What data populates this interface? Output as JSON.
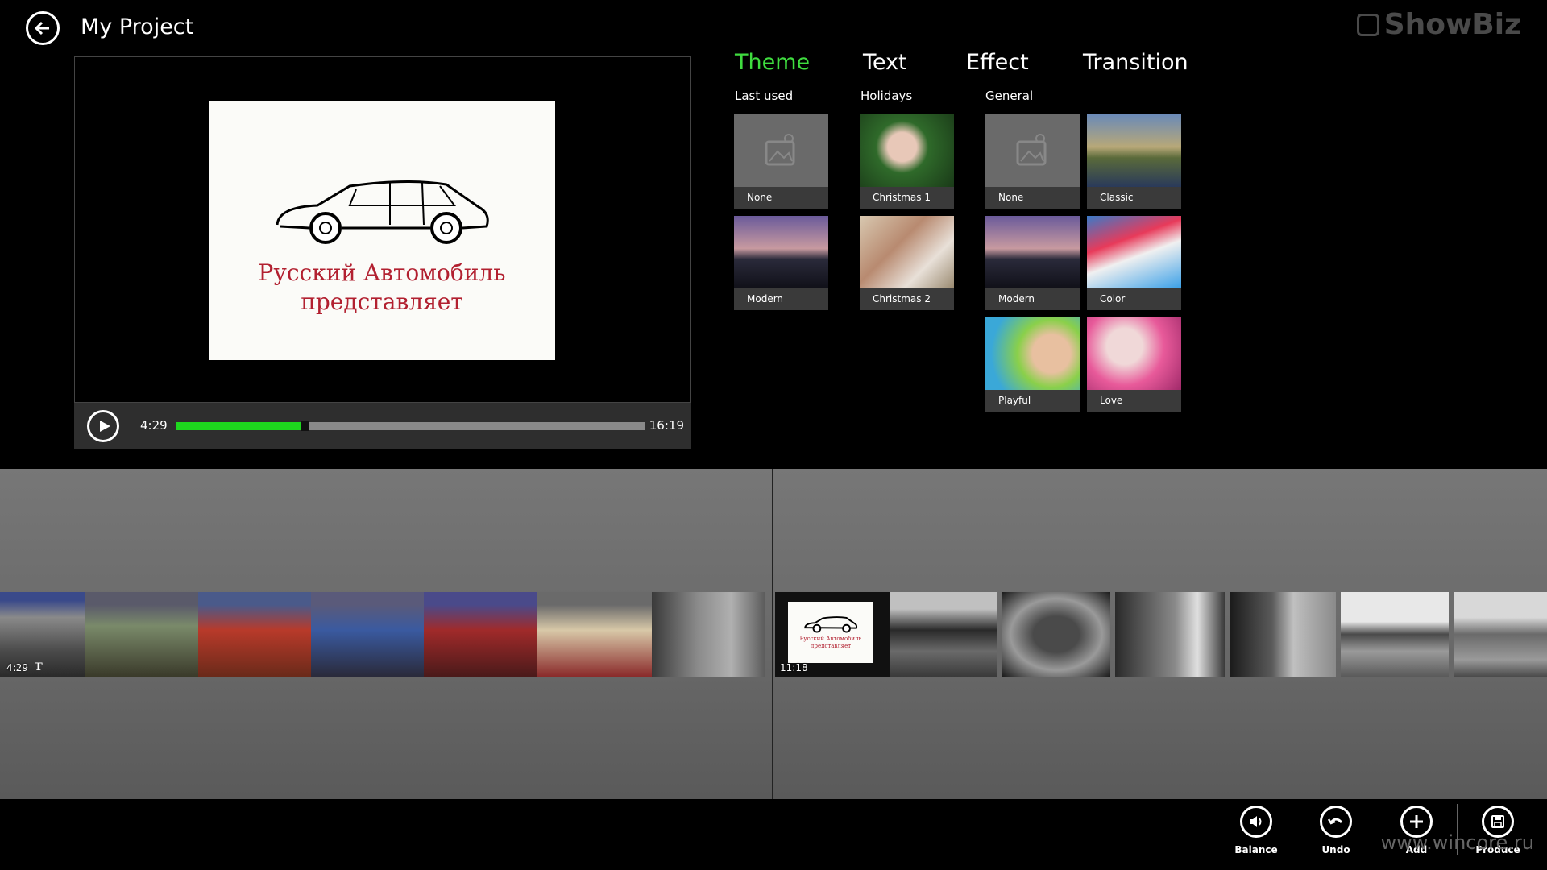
{
  "header": {
    "title": "My Project",
    "brand": "ShowBiz"
  },
  "player": {
    "slide_caption_line1": "Русский Автомобиль",
    "slide_caption_line2": "представляет",
    "current_time": "4:29",
    "total_time": "16:19",
    "progress": 0.27
  },
  "tabs": [
    {
      "label": "Theme",
      "active": true
    },
    {
      "label": "Text",
      "active": false
    },
    {
      "label": "Effect",
      "active": false
    },
    {
      "label": "Transition",
      "active": false
    }
  ],
  "groups": {
    "last_used": {
      "label": "Last used",
      "items": [
        {
          "label": "None"
        },
        {
          "label": "Modern"
        }
      ]
    },
    "holidays": {
      "label": "Holidays",
      "items": [
        {
          "label": "Christmas 1"
        },
        {
          "label": "Christmas 2"
        }
      ]
    },
    "general": {
      "label": "General",
      "items": [
        {
          "label": "None"
        },
        {
          "label": "Classic"
        },
        {
          "label": "Modern"
        },
        {
          "label": "Color"
        },
        {
          "label": "Playful"
        },
        {
          "label": "Love"
        }
      ]
    }
  },
  "timeline": {
    "clip1_time": "4:29",
    "clip1_flag": "T",
    "clip2_time": "11:18"
  },
  "appbar": {
    "balance": "Balance",
    "undo": "Undo",
    "add": "Add",
    "produce": "Produce"
  },
  "watermark": "www.wincore.ru",
  "colors": {
    "accent": "#3fdc3f",
    "progress": "#1ed71e",
    "caption": "#b22030"
  }
}
